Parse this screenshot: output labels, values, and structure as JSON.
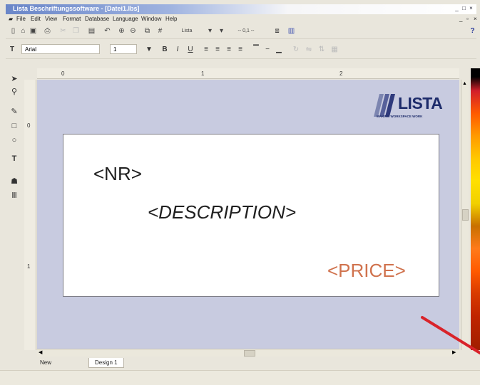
{
  "window": {
    "title": "Lista Beschriftungssoftware - [Datei1.lbs]"
  },
  "menu": [
    "File",
    "Edit",
    "View",
    "Format",
    "Database",
    "Language",
    "Window",
    "Help"
  ],
  "toolbar1": {
    "layer_label": "Lista",
    "zoom_value": "-- 0,1 --"
  },
  "toolbar2": {
    "font_name": "Arial",
    "font_size": "1"
  },
  "ruler": {
    "top_marks": [
      "0",
      "1",
      "2"
    ],
    "left_marks": [
      "0",
      "1"
    ]
  },
  "label": {
    "nr": "<NR>",
    "description": "<DESCRIPTION>",
    "price": "<PRICE>",
    "logo_text": "LISTA",
    "logo_tagline": "MAKING WORKSPACE WORK"
  },
  "tabs": [
    "New",
    "Design 1"
  ],
  "colors": {
    "canvas": "#c8cbe0",
    "price_text": "#d0724d",
    "logo": "#1e2c6b",
    "annotation_arrow": "#d9232a"
  }
}
